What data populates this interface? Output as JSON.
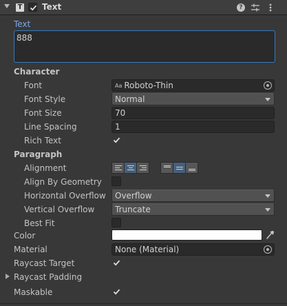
{
  "header": {
    "title": "Text",
    "component_icon_text": "T",
    "icons": [
      "fold-arrow-icon",
      "text-component-icon",
      "enabled-checkbox",
      "help-icon",
      "presets-icon",
      "context-menu-icon"
    ]
  },
  "text": {
    "label": "Text",
    "value": "888"
  },
  "character": {
    "section": "Character",
    "font_label": "Font",
    "font_value": "Roboto-Thin",
    "font_icon_text": "Aa",
    "font_style_label": "Font Style",
    "font_style_value": "Normal",
    "font_size_label": "Font Size",
    "font_size_value": "70",
    "line_spacing_label": "Line Spacing",
    "line_spacing_value": "1",
    "rich_text_label": "Rich Text",
    "rich_text_checked": true
  },
  "paragraph": {
    "section": "Paragraph",
    "alignment_label": "Alignment",
    "horizontal_alignment_options": [
      "left",
      "center",
      "right"
    ],
    "horizontal_alignment_selected": "center",
    "vertical_alignment_options": [
      "upper",
      "middle",
      "lower"
    ],
    "vertical_alignment_selected": "middle",
    "align_by_geometry_label": "Align By Geometry",
    "align_by_geometry_checked": false,
    "horizontal_overflow_label": "Horizontal Overflow",
    "horizontal_overflow_value": "Overflow",
    "vertical_overflow_label": "Vertical Overflow",
    "vertical_overflow_value": "Truncate",
    "best_fit_label": "Best Fit",
    "best_fit_checked": false
  },
  "color": {
    "label": "Color",
    "value": "#ffffff"
  },
  "material": {
    "label": "Material",
    "value": "None (Material)"
  },
  "raycast_target": {
    "label": "Raycast Target",
    "checked": true
  },
  "raycast_padding": {
    "label": "Raycast Padding"
  },
  "maskable": {
    "label": "Maskable",
    "checked": true
  },
  "colors": {
    "background": "#383838",
    "field": "#2a2a2a",
    "focus_border": "#3a79bb",
    "focus_label": "#7ea7e6",
    "selected_button": "#46607c"
  }
}
